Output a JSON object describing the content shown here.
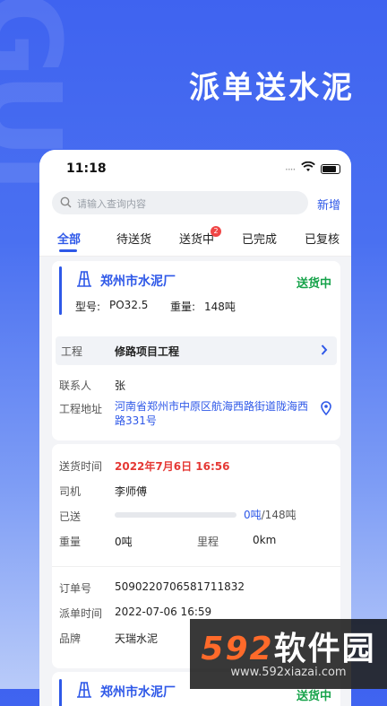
{
  "hero": {
    "title": "派单送水泥",
    "bg_watermark": "GUI"
  },
  "status_bar": {
    "time": "11:18"
  },
  "search": {
    "placeholder": "请输入查询内容",
    "add_label": "新增"
  },
  "tabs": [
    {
      "label": "全部",
      "active": true
    },
    {
      "label": "待送货"
    },
    {
      "label": "送货中",
      "badge": "2"
    },
    {
      "label": "已完成"
    },
    {
      "label": "已复核"
    }
  ],
  "order1": {
    "factory": "郑州市水泥厂",
    "status": "送货中",
    "model_label": "型号:",
    "model_value": "PO32.5",
    "weight_label": "重量:",
    "weight_value": "148吨",
    "project_label": "工程",
    "project_value": "修路项目工程",
    "contact_label": "联系人",
    "contact_value": "张",
    "address_label": "工程地址",
    "address_value": "河南省郑州市中原区航海西路街道陇海西路331号",
    "delivery_time_label": "送货时间",
    "delivery_time_value": "2022年7月6日 16:56",
    "driver_label": "司机",
    "driver_value": "李师傅",
    "sent_label": "已送",
    "sent_value": "0吨",
    "sent_total": "/148吨",
    "sent_fraction": 0,
    "weight2_label": "重量",
    "weight2_value": "0吨",
    "mileage_label": "里程",
    "mileage_value": "0km",
    "order_no_label": "订单号",
    "order_no_value": "5090220706581711832",
    "dispatch_time_label": "派单时间",
    "dispatch_time_value": "2022-07-06 16:59",
    "brand_label": "品牌",
    "brand_value": "天瑞水泥"
  },
  "order2": {
    "factory": "郑州市水泥厂",
    "status": "送货中"
  },
  "site_watermark": {
    "logo_num": "592",
    "logo_text": "软件园",
    "url": "www.592xiazai.com"
  },
  "colors": {
    "accent": "#2e58e8",
    "status_green": "#16a34a",
    "time_red": "#e53935",
    "hero_bg": "#3f63f0"
  }
}
